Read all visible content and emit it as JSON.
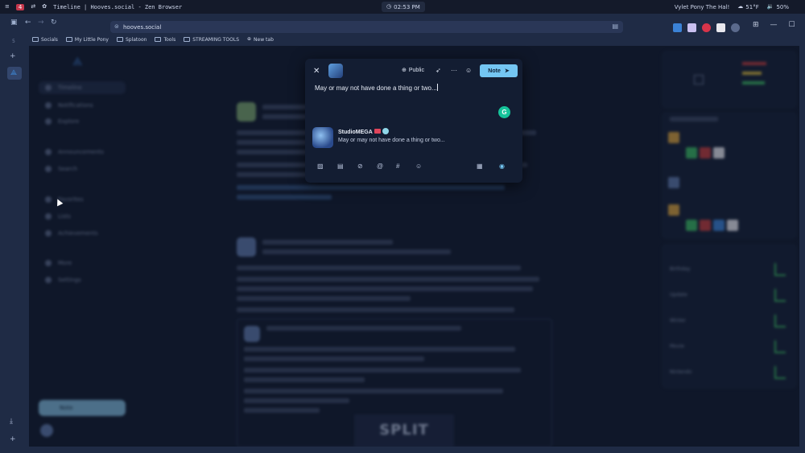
{
  "system_bar": {
    "workspace": "4",
    "window_title": "Timeline | Hooves.social - Zen Browser",
    "clock": "02:53 PM",
    "now_playing": "Vylet Pony The Hal!",
    "temperature": "51°F",
    "volume": "50%"
  },
  "browser": {
    "url": "hooves.social",
    "bookmarks": [
      "Socials",
      "My Little Pony",
      "Splatoon",
      "Tools",
      "STREAMING TOOLS",
      "New tab"
    ],
    "sidebar_count": "5"
  },
  "background_page": {
    "nav_items": [
      "Timeline",
      "Notifications",
      "Explore",
      "Announcements",
      "Search",
      "Favorites",
      "Lists",
      "Achievements",
      "More",
      "Settings"
    ],
    "note_button": "Note",
    "split_fiction_image_text": "SPLIT FICTION",
    "trending_items": [
      "Birthday",
      "Update",
      "Winter",
      "Movie",
      "Nintendo"
    ]
  },
  "compose": {
    "visibility": "Public",
    "post_button": "Note",
    "text": "May or may not have done a thing or two...",
    "quote": {
      "author": "StudioMEGA",
      "text": "May or may not have done a thing or two..."
    }
  },
  "colors": {
    "accent": "#74c6f2",
    "modal_bg": "#131d32",
    "page_bg": "#0f1729",
    "chrome_bg": "#1f2b45"
  },
  "icons": {
    "close": "close-icon",
    "visibility": "globe-icon",
    "rocket": "rocket-icon",
    "more": "more-icon",
    "emoji": "emoji-icon",
    "grammarly": "grammarly-icon"
  }
}
